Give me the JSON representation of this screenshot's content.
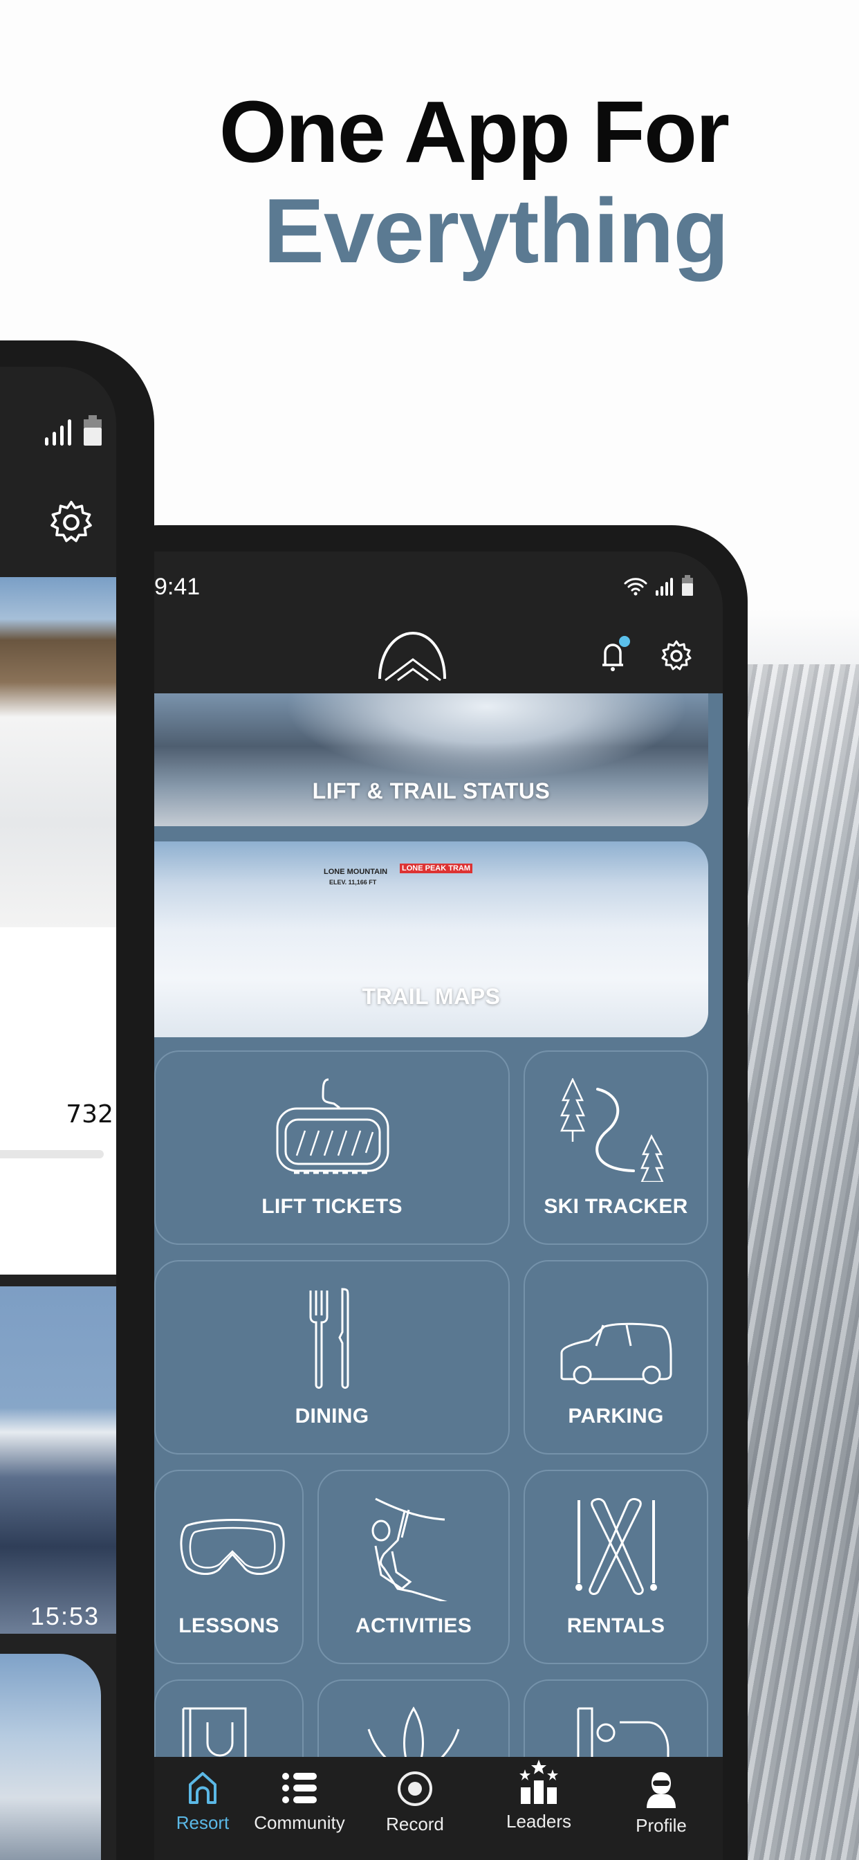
{
  "headline": {
    "line1": "One App For",
    "line2": "Everything",
    "accent_color": "#5b7a92"
  },
  "front_phone": {
    "status_bar": {
      "time": "9:41",
      "icons": [
        "wifi-icon",
        "signal-icon",
        "battery-icon"
      ]
    },
    "header": {
      "logo": "mountain-logo",
      "notification_dot_color": "#5bc0eb",
      "icons": [
        "bell-icon",
        "gear-icon"
      ]
    },
    "cards": [
      {
        "label": "LIFT & TRAIL STATUS"
      },
      {
        "label": "TRAIL MAPS",
        "map_labels": {
          "peak": "LONE MOUNTAIN",
          "elevation": "ELEV. 11,166 FT",
          "tram": "LONE PEAK TRAM"
        }
      }
    ],
    "tiles": [
      {
        "label": "LIFT TICKETS",
        "icon": "gondola-icon"
      },
      {
        "label": "SKI TRACKER",
        "icon": "ski-trail-icon"
      },
      {
        "label": "DINING",
        "icon": "fork-knife-icon"
      },
      {
        "label": "PARKING",
        "icon": "car-icon"
      },
      {
        "label": "LESSONS",
        "icon": "goggles-icon"
      },
      {
        "label": "ACTIVITIES",
        "icon": "zipline-icon"
      },
      {
        "label": "RENTALS",
        "icon": "skis-icon"
      }
    ],
    "tile_bg_color": "#5a7891",
    "nav": [
      {
        "label": "Resort",
        "visible_label": "esort",
        "icon": "home-icon",
        "active": true
      },
      {
        "label": "Community",
        "icon": "list-icon"
      },
      {
        "label": "Record",
        "icon": "record-icon"
      },
      {
        "label": "Leaders",
        "icon": "leaderboard-icon"
      },
      {
        "label": "Profile",
        "icon": "profile-icon"
      }
    ],
    "active_color": "#5bb8e6"
  },
  "back_phone": {
    "status_icons": [
      "signal-icon",
      "battery-icon"
    ],
    "stat_value": "732",
    "photo_timestamp": "15:53"
  }
}
